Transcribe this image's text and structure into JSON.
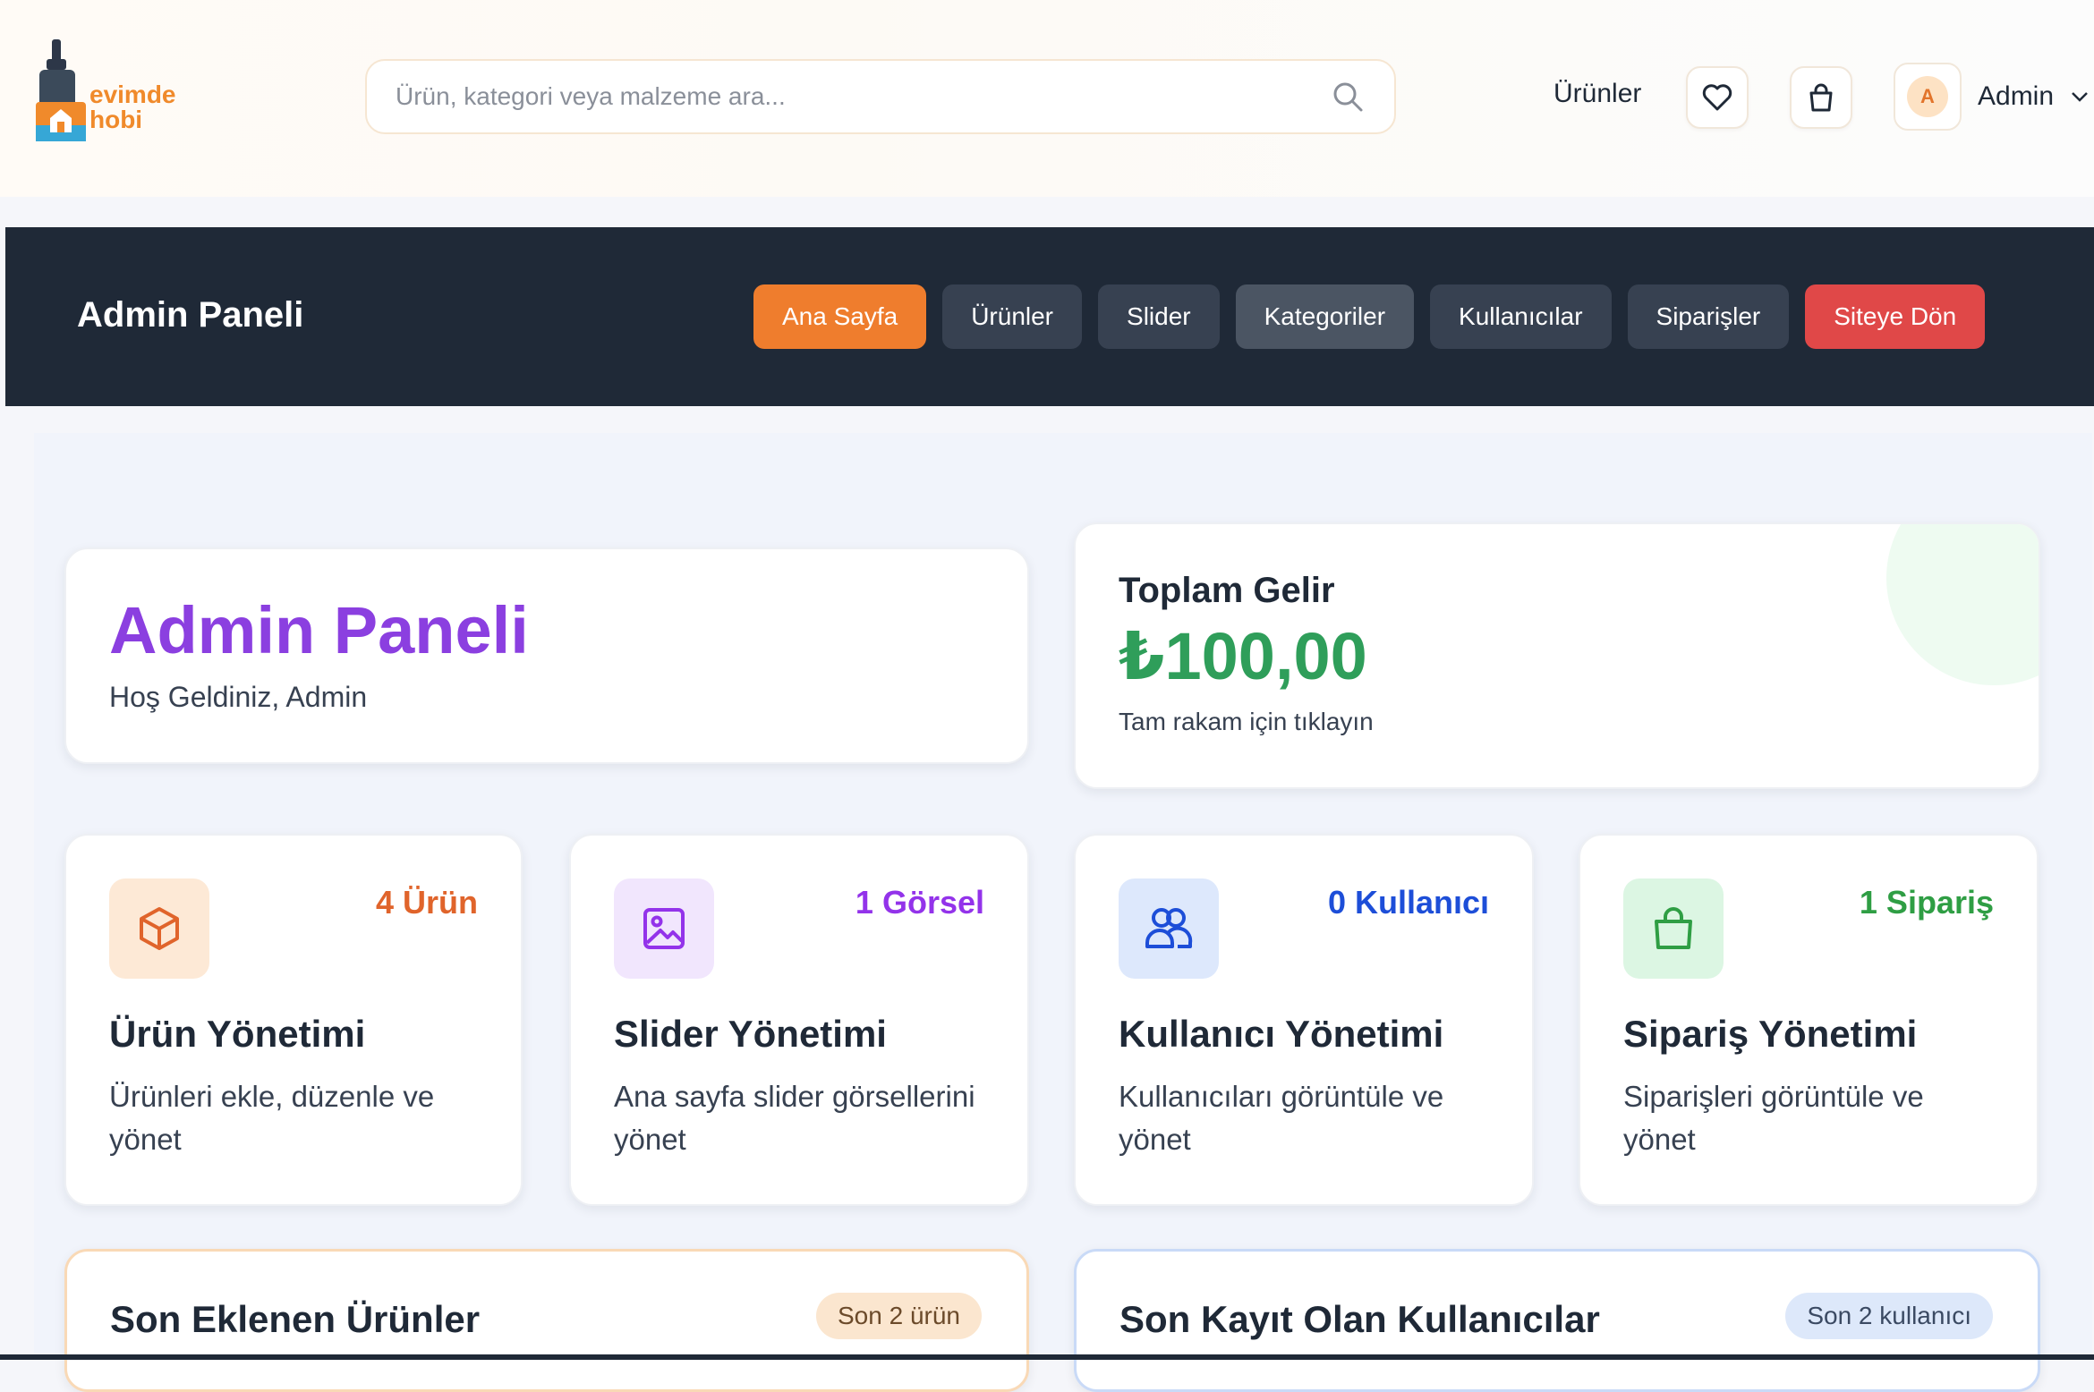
{
  "header": {
    "logo_line1": "evimde",
    "logo_line2": "hobi",
    "search_placeholder": "Ürün, kategori veya malzeme ara...",
    "nav_products": "Ürünler",
    "user_initial": "A",
    "user_name": "Admin"
  },
  "admin_bar": {
    "title": "Admin Paneli",
    "nav": [
      "Ana Sayfa",
      "Ürünler",
      "Slider",
      "Kategoriler",
      "Kullanıcılar",
      "Siparişler",
      "Siteye Dön"
    ]
  },
  "welcome": {
    "title": "Admin Paneli",
    "subtitle": "Hoş Geldiniz, Admin"
  },
  "revenue": {
    "title": "Toplam Gelir",
    "amount": "₺100,00",
    "hint": "Tam rakam için tıklayın"
  },
  "stats": [
    {
      "count": "4 Ürün",
      "title": "Ürün Yönetimi",
      "desc": "Ürünleri ekle, düzenle ve yönet",
      "color": "#e0642b",
      "bg": "#fde9d6",
      "icon": "box-icon"
    },
    {
      "count": "1 Görsel",
      "title": "Slider Yönetimi",
      "desc": "Ana sayfa slider görsellerini yönet",
      "color": "#9333ea",
      "bg": "#f1e6fd",
      "icon": "image-icon"
    },
    {
      "count": "0 Kullanıcı",
      "title": "Kullanıcı Yönetimi",
      "desc": "Kullanıcıları görüntüle ve yönet",
      "color": "#1d4ed8",
      "bg": "#dde8fc",
      "icon": "users-icon"
    },
    {
      "count": "1 Sipariş",
      "title": "Sipariş Yönetimi",
      "desc": "Siparişleri görüntüle ve yönet",
      "color": "#2f9e44",
      "bg": "#dcf6e3",
      "icon": "bag-icon"
    }
  ],
  "recent_products": {
    "title": "Son Eklenen Ürünler",
    "badge": "Son 2 ürün"
  },
  "recent_users": {
    "title": "Son Kayıt Olan Kullanıcılar",
    "badge": "Son 2 kullanıcı"
  }
}
